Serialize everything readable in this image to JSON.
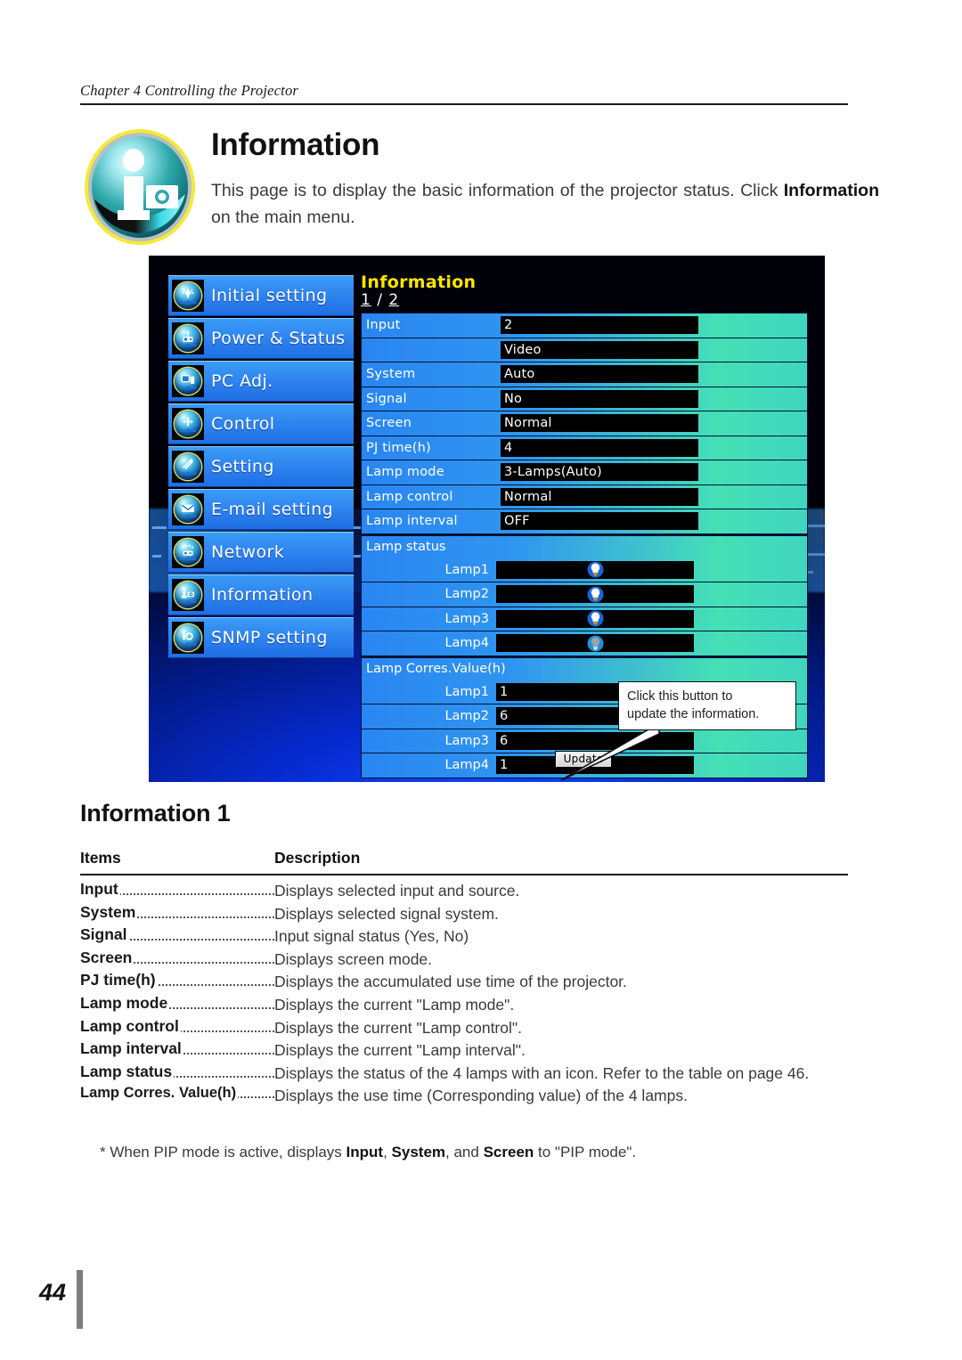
{
  "header": {
    "chapter": "Chapter 4 Controlling the Projector"
  },
  "title_block": {
    "icon_name": "information-badge-icon",
    "title": "Information",
    "intro_part1": "This page is to display the basic information of the projector status. Click ",
    "intro_bold": "Information",
    "intro_part2": " on the main menu."
  },
  "screenshot": {
    "sidebar": {
      "items": [
        {
          "label": "Initial setting",
          "icon": "gear-sun-icon"
        },
        {
          "label": "Power & Status",
          "icon": "projector-alert-icon"
        },
        {
          "label": "PC Adj.",
          "icon": "monitor-icon"
        },
        {
          "label": "Control",
          "icon": "dpad-icon"
        },
        {
          "label": "Setting",
          "icon": "tools-icon"
        },
        {
          "label": "E-mail setting",
          "icon": "envelope-icon"
        },
        {
          "label": "Network",
          "icon": "network-icon"
        },
        {
          "label": "Information",
          "icon": "info-icon"
        },
        {
          "label": "SNMP setting",
          "icon": "snmp-gear-icon"
        }
      ]
    },
    "panel": {
      "title": "Information",
      "page_current": "1",
      "page_separator": " / ",
      "page_total": "2",
      "rows": [
        {
          "key": "Input",
          "value": "2"
        },
        {
          "key": "",
          "value": "Video"
        },
        {
          "key": "System",
          "value": "Auto"
        },
        {
          "key": "Signal",
          "value": "No"
        },
        {
          "key": "Screen",
          "value": "Normal"
        },
        {
          "key": "PJ time(h)",
          "value": "4"
        },
        {
          "key": "Lamp mode",
          "value": "3-Lamps(Auto)"
        },
        {
          "key": "Lamp control",
          "value": "Normal"
        },
        {
          "key": "Lamp interval",
          "value": "OFF"
        }
      ],
      "lamp_status": {
        "heading": "Lamp status",
        "lamps": [
          {
            "label": "Lamp1",
            "state": "on",
            "icon": "lamp-on-icon"
          },
          {
            "label": "Lamp2",
            "state": "on",
            "icon": "lamp-on-icon"
          },
          {
            "label": "Lamp3",
            "state": "on",
            "icon": "lamp-on-icon"
          },
          {
            "label": "Lamp4",
            "state": "off",
            "icon": "lamp-off-icon"
          }
        ]
      },
      "lamp_corres": {
        "heading": "Lamp Corres.Value(h)",
        "lamps": [
          {
            "label": "Lamp1",
            "value": "1"
          },
          {
            "label": "Lamp2",
            "value": "6"
          },
          {
            "label": "Lamp3",
            "value": "6"
          },
          {
            "label": "Lamp4",
            "value": "1"
          }
        ]
      },
      "update_button": "Update"
    },
    "callout": {
      "line1": "Click this button to",
      "line2": "update the information."
    },
    "colors": {
      "panel_title": "#ffe600",
      "row_blue": "#2a86f2",
      "row_teal": "#45e0b5",
      "value_bg": "#000000"
    }
  },
  "section": {
    "title": "Information 1",
    "columns": {
      "items": "Items",
      "description": "Description"
    },
    "rows": [
      {
        "term": "Input",
        "desc": "Displays selected input and source."
      },
      {
        "term": "System",
        "desc": "Displays selected signal system."
      },
      {
        "term": "Signal",
        "desc": "Input signal status (Yes, No)"
      },
      {
        "term": "Screen",
        "desc": "Displays screen mode."
      },
      {
        "term": "PJ time(h)",
        "desc": "Displays the accumulated use time of the projector."
      },
      {
        "term": "Lamp mode",
        "desc": "Displays the current \"Lamp mode\"."
      },
      {
        "term": "Lamp control",
        "desc": "Displays the current \"Lamp control\"."
      },
      {
        "term": "Lamp interval",
        "desc": "Displays the current \"Lamp interval\"."
      },
      {
        "term": "Lamp status",
        "desc": "Displays the status of the 4 lamps with an icon. Refer to the table on page 46."
      },
      {
        "term": "Lamp Corres. Value(h)",
        "desc": "Displays the use time (Corresponding value) of the 4 lamps."
      }
    ],
    "note": {
      "p1": "* When PIP mode is active, displays ",
      "b1": "Input",
      "p2": ", ",
      "b2": "System",
      "p3": ", and ",
      "b3": "Screen",
      "p4": " to \"PIP mode\"."
    }
  },
  "footer": {
    "page_number": "44"
  }
}
